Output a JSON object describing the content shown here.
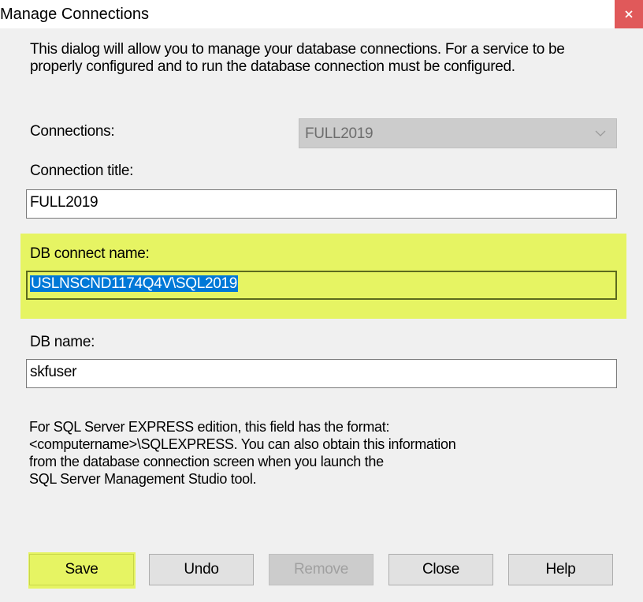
{
  "window": {
    "title": "Manage Connections",
    "close_icon": "close-icon"
  },
  "intro_text": "This dialog will allow you to manage your database connections. For a service to be properly configured and to run the database connection must be configured.",
  "connections": {
    "label": "Connections:",
    "selected_value": "FULL2019",
    "enabled": false
  },
  "connection_title": {
    "label": "Connection title:",
    "value": "FULL2019"
  },
  "db_connect_name": {
    "label": "DB connect name:",
    "value": "USLNSCND1174Q4V\\SQL2019",
    "highlight_color": "#e6f463"
  },
  "db_name": {
    "label": "DB name:",
    "value": "skfuser"
  },
  "note_lines": [
    "For SQL Server EXPRESS edition, this field has the format:",
    "<computername>\\SQLEXPRESS. You can also obtain this information",
    "from the database connection screen when you launch the",
    "SQL Server Management Studio tool."
  ],
  "buttons": {
    "save": "Save",
    "undo": "Undo",
    "remove": "Remove",
    "close": "Close",
    "help": "Help"
  },
  "colors": {
    "dialog_bg": "#f0f0f0",
    "close_button": "#e0595a",
    "selection": "#0078d7",
    "highlight": "#e6f463"
  }
}
